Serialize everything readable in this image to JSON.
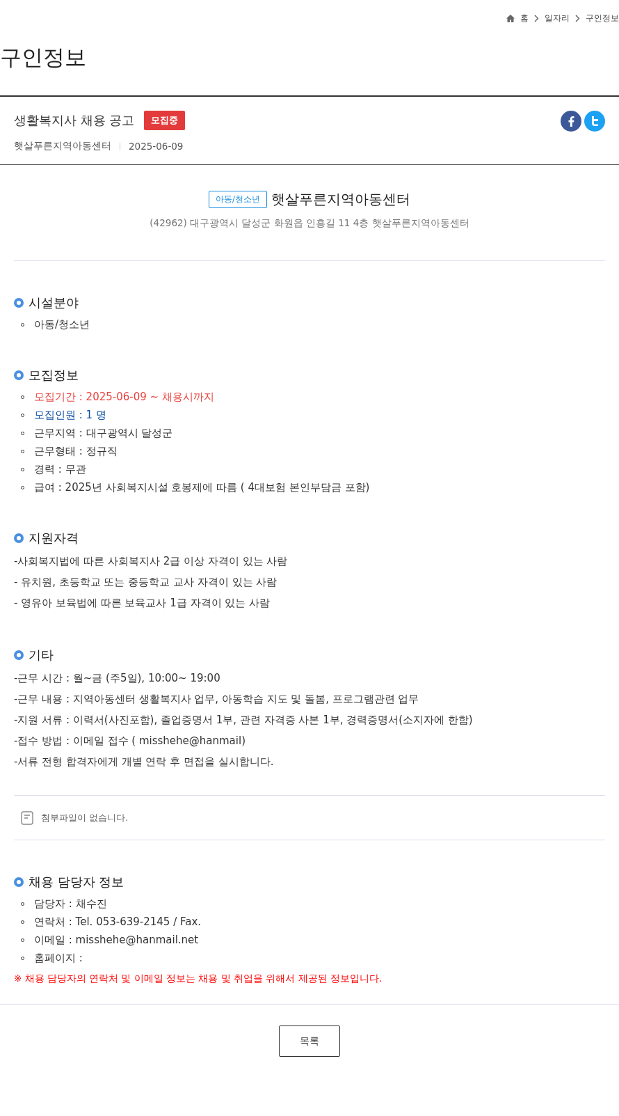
{
  "breadcrumb": [
    "홈",
    "일자리",
    "구인정보"
  ],
  "page_title": "구인정보",
  "post": {
    "title": "생활복지사 채용 공고",
    "status": "모집중",
    "organization": "햇살푸른지역아동센터",
    "date": "2025-06-09"
  },
  "org": {
    "category": "아동/청소년",
    "name": "햇살푸른지역아동센터",
    "address": "(42962) 대구광역시 달성군 화원읍 인흥길 11 4층 햇살푸른지역아동센터"
  },
  "sections": [
    {
      "heading": "시설분야",
      "kind": "bullets",
      "items": [
        {
          "text": "아동/청소년",
          "color": "#333333"
        }
      ]
    },
    {
      "heading": "모집정보",
      "kind": "bullets",
      "items": [
        {
          "text": "모집기간 : 2025-06-09 ~ 채용시까지",
          "color": "#e8413c"
        },
        {
          "text": "모집인원 : 1 명",
          "color": "#0b4ea2"
        },
        {
          "text": "근무지역 : 대구광역시 달성군",
          "color": "#333333"
        },
        {
          "text": "근무형태 : 정규직",
          "color": "#333333"
        },
        {
          "text": "경력 : 무관",
          "color": "#333333"
        },
        {
          "text": "급여 : 2025년 사회복지시설 호봉제에 따름 ( 4대보험 본인부담금 포함)",
          "color": "#333333"
        }
      ]
    },
    {
      "heading": "지원자격",
      "kind": "lines",
      "items": [
        {
          "text": "-사회복지법에 따른 사회복지사 2급 이상 자격이 있는 사람",
          "color": "#333333"
        },
        {
          "text": "- 유치원, 초등학교 또는 중등학교 교사 자격이 있는 사람",
          "color": "#333333"
        },
        {
          "text": "- 영유아 보육법에 따른 보육교사 1급 자격이 있는 사람",
          "color": "#333333"
        }
      ]
    },
    {
      "heading": "기타",
      "kind": "lines",
      "items": [
        {
          "text": "-근무 시간 : 월~금 (주5일), 10:00~ 19:00",
          "color": "#333333"
        },
        {
          "text": "-근무 내용 : 지역아동센터 생활복지사 업무, 아동학습 지도 및 돌봄, 프로그램관련 업무",
          "color": "#333333"
        },
        {
          "text": "-지원 서류 : 이력서(사진포함), 졸업증명서 1부, 관련 자격증 사본 1부, 경력증명서(소지자에 한함)",
          "color": "#333333"
        },
        {
          "text": "-접수 방법 : 이메일 접수 ( misshehe@hanmail)",
          "color": "#333333"
        },
        {
          "text": "-서류 전형 합격자에게 개별 연락 후 면접을 실시합니다.",
          "color": "#333333"
        }
      ]
    }
  ],
  "attachment": "첨부파일이 없습니다.",
  "contact": {
    "heading": "채용 담당자 정보",
    "items": [
      {
        "text": "담당자 : 채수진",
        "color": "#333333"
      },
      {
        "text": "연락처 : Tel. 053-639-2145 / Fax.",
        "color": "#333333"
      },
      {
        "text": "이메일 : misshehe@hanmail.net",
        "color": "#333333"
      },
      {
        "text": "홈페이지 :",
        "color": "#333333"
      }
    ],
    "notice": "※ 채용 담당자의 연락처 및 이메일 정보는 채용 및 취업을 위해서 제공된 정보입니다."
  },
  "list_button": "목록"
}
